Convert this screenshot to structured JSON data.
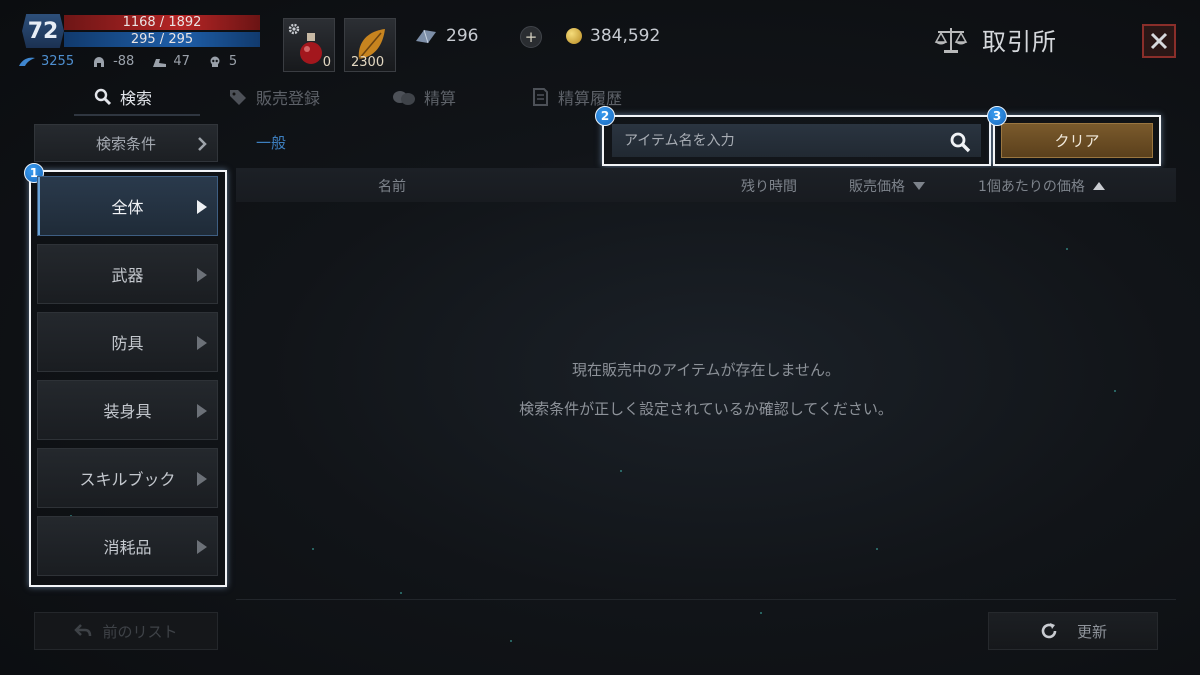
{
  "player": {
    "level": "72",
    "hp": "1168 / 1892",
    "mp": "295 / 295",
    "stats": [
      {
        "icon": "wing-icon",
        "value": "3255"
      },
      {
        "icon": "helmet-icon",
        "value": "-88"
      },
      {
        "icon": "boot-icon",
        "value": "47"
      },
      {
        "icon": "skull-icon",
        "value": "5"
      }
    ]
  },
  "quick_slots": [
    {
      "icon": "potion-icon",
      "count": "0"
    },
    {
      "icon": "leaf-icon",
      "count": "2300"
    }
  ],
  "currency": {
    "crystal": "296",
    "gold": "384,592"
  },
  "window": {
    "title": "取引所"
  },
  "tabs": [
    {
      "label": "検索",
      "icon": "search-icon",
      "active": true
    },
    {
      "label": "販売登録",
      "icon": "tag-icon",
      "active": false
    },
    {
      "label": "精算",
      "icon": "coins-icon",
      "active": false
    },
    {
      "label": "精算履歴",
      "icon": "history-icon",
      "active": false
    }
  ],
  "sidebar": {
    "criteria_label": "検索条件",
    "categories": [
      {
        "label": "全体",
        "active": true
      },
      {
        "label": "武器",
        "active": false
      },
      {
        "label": "防具",
        "active": false
      },
      {
        "label": "装身具",
        "active": false
      },
      {
        "label": "スキルブック",
        "active": false
      },
      {
        "label": "消耗品",
        "active": false
      }
    ],
    "prev_list_label": "前のリスト"
  },
  "main": {
    "subcategory": "一般",
    "search_placeholder": "アイテム名を入力",
    "clear_label": "クリア",
    "columns": {
      "name": "名前",
      "remaining": "残り時間",
      "price": "販売価格",
      "unit_price": "1個あたりの価格"
    },
    "empty_line1": "現在販売中のアイテムが存在しません。",
    "empty_line2": "検索条件が正しく設定されているか確認してください。",
    "refresh_label": "更新"
  },
  "callouts": [
    "1",
    "2",
    "3"
  ],
  "colors": {
    "accent_blue": "#3d7fbf",
    "clear_button": "#7a5a2c",
    "hp": "#b52525",
    "mp": "#1e5ea8",
    "close": "#8a2e2a"
  }
}
